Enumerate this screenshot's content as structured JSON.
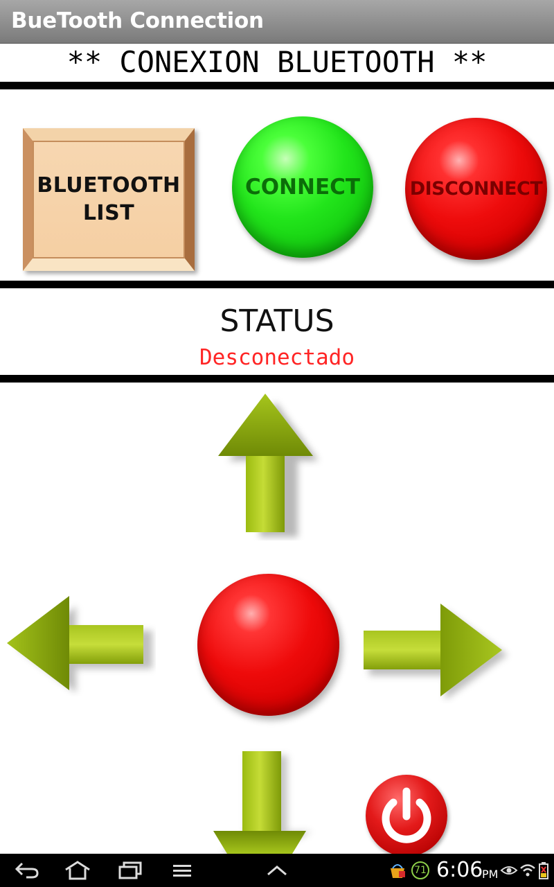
{
  "app": {
    "window_title": "BueTooth Connection",
    "heading": "** CONEXION BLUETOOTH **"
  },
  "controls": {
    "bluetooth_list_line1": "BLUETOOTH",
    "bluetooth_list_line2": "LIST",
    "connect_label": "CONNECT",
    "disconnect_label": "DISCONNECT"
  },
  "status": {
    "label": "STATUS",
    "value": "Desconectado",
    "value_color": "#ff2525"
  },
  "direction_pad": {
    "up": "arrow-up-icon",
    "down": "arrow-down-icon",
    "left": "arrow-left-icon",
    "right": "arrow-right-icon",
    "center": "stop-button",
    "arrow_color": "#8aa60e"
  },
  "power_button": {
    "icon": "power-icon",
    "color": "#d61212"
  },
  "system_bar": {
    "time": "6:06",
    "ampm": "PM",
    "notification_count": "71",
    "icons": [
      "back-icon",
      "home-icon",
      "recent-apps-icon",
      "menu-icon",
      "up-chevron-icon",
      "store-icon",
      "eye-icon",
      "wifi-icon",
      "battery-icon"
    ]
  }
}
